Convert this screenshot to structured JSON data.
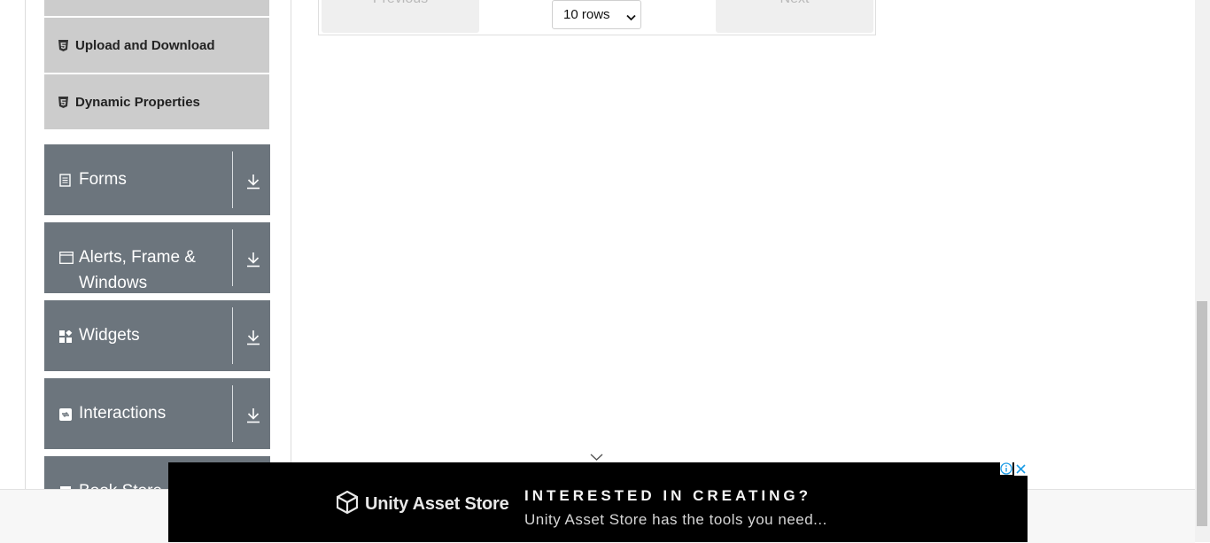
{
  "sidebar": {
    "sub_items": [
      {
        "label": "Upload and Download",
        "icon": "html5-icon"
      },
      {
        "label": "Dynamic Properties",
        "icon": "html5-icon"
      }
    ],
    "groups": [
      {
        "label": "Forms",
        "icon": "form-icon"
      },
      {
        "label_line1": "Alerts, Frame &",
        "label_line2": "Windows",
        "icon": "window-icon"
      },
      {
        "label": "Widgets",
        "icon": "widgets-icon"
      },
      {
        "label": "Interactions",
        "icon": "interactions-icon"
      },
      {
        "label": "Book Store",
        "icon": "book-icon"
      }
    ]
  },
  "pagination": {
    "previous_label": "Previous",
    "next_label": "Next",
    "rows_value": "10 rows"
  },
  "ad": {
    "brand": "Unity Asset Store",
    "headline": "INTERESTED IN CREATING?",
    "subline": "Unity Asset Store has the tools you need..."
  },
  "colors": {
    "group_bg": "#6c757d",
    "sub_item_bg": "#cccccc",
    "ad_bg": "#000000"
  }
}
